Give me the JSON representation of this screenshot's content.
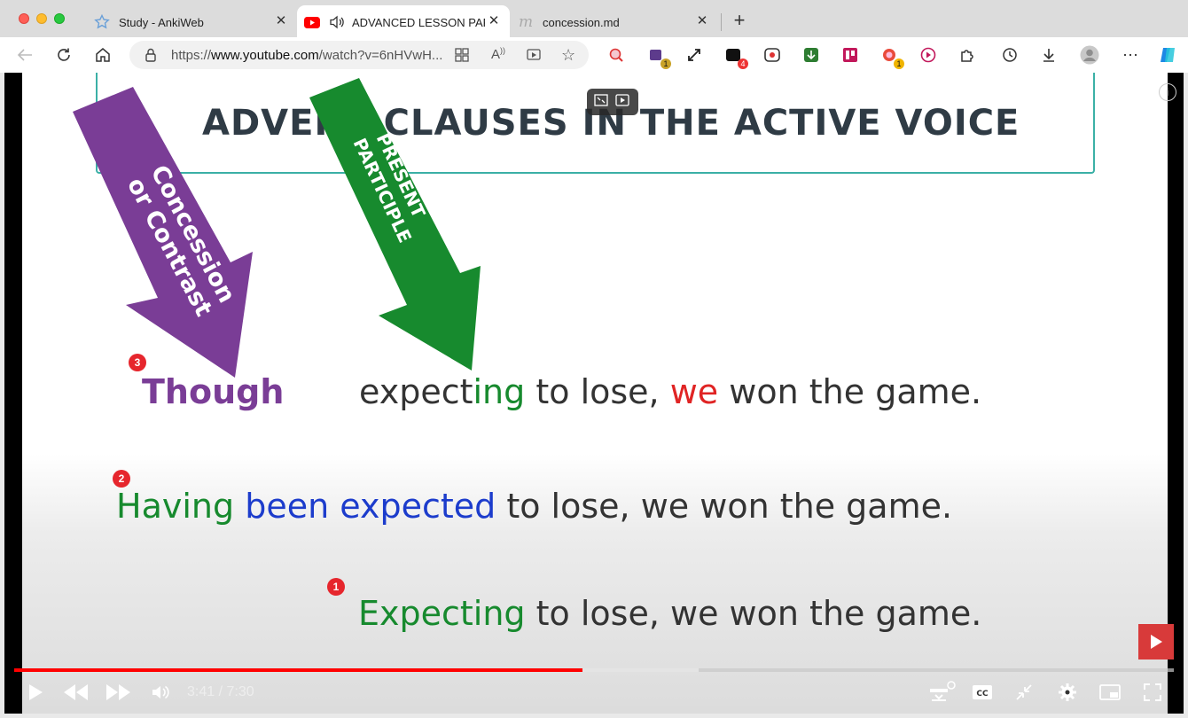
{
  "browser": {
    "tabs": [
      {
        "title": "Study - AnkiWeb",
        "active": false
      },
      {
        "title": "ADVANCED LESSON PART",
        "active": true
      },
      {
        "title": "concession.md",
        "active": false
      }
    ],
    "url_prefix": "https://",
    "url_domain": "www.youtube.com",
    "url_rest": "/watch?v=6nHVwH...",
    "extension_badges": {
      "badge1": "1",
      "badge2": "4",
      "badge3": "1"
    }
  },
  "slide": {
    "title": "ADVERB CLAUSES IN THE ACTIVE VOICE",
    "arrow_purple": {
      "line1": "Concession",
      "line2": "or Contrast"
    },
    "arrow_green": {
      "line1": "PRESENT",
      "line2": "PARTICIPLE"
    },
    "sentence3": {
      "word1": "Though",
      "part1": "expect",
      "part2": "ing",
      "part3": " to lose, ",
      "part4": "we",
      "part5": " won the game."
    },
    "sentence2": {
      "part1": "Having",
      "part2": " been expected",
      "part3": " to lose, we won the game."
    },
    "sentence1": {
      "part1": "Expecting",
      "part2": " to lose, we won the game."
    },
    "markers": {
      "m1": "1",
      "m2": "2",
      "m3": "3"
    }
  },
  "player": {
    "time_current": "3:41",
    "time_total": "7:30",
    "time_display": "3:41 / 7:30",
    "progress_played": 0.49,
    "progress_buffered": 0.59
  },
  "colors": {
    "purple": "#7a3d96",
    "green": "#178a2e",
    "red": "#e02424",
    "blue": "#1c3ccc",
    "youtube_red": "#ff0000"
  }
}
